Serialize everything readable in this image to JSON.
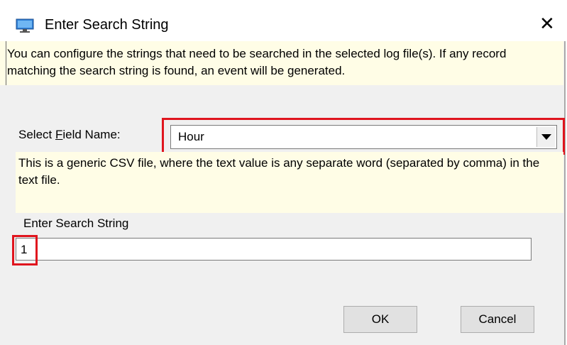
{
  "window": {
    "title": "Enter Search String",
    "app_icon": "monitor-icon",
    "close_icon": "close-icon",
    "close_glyph": "✕"
  },
  "info": {
    "text": "You can configure the strings that need to be searched in the selected log file(s). If any record matching the search string is found, an event will be generated."
  },
  "field": {
    "label_prefix": "Select ",
    "label_accel": "F",
    "label_suffix": "ield Name:",
    "selected": "Hour"
  },
  "description": {
    "text": "This is a generic CSV file, where the text value is any separate word (separated by comma) in the text file."
  },
  "search": {
    "label": "Enter Search String",
    "value": "1"
  },
  "buttons": {
    "ok": "OK",
    "cancel": "Cancel"
  },
  "colors": {
    "highlight": "#e0151e",
    "info_background": "#fffde6",
    "dialog_background": "#f0f0f0"
  }
}
